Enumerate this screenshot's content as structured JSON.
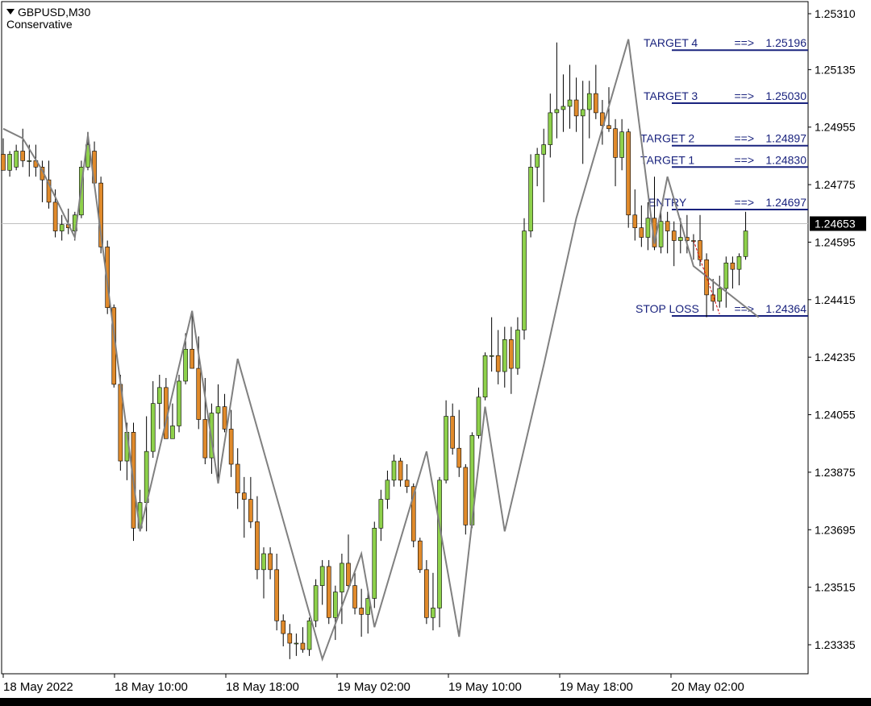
{
  "header": {
    "symbol": "GBPUSD,M30",
    "indicator": "Conservative"
  },
  "colors": {
    "bull": "#8ed14b",
    "bear": "#e08a2b",
    "wick": "#000000",
    "zigzag": "#808080",
    "level_line": "#1a237e",
    "level_text": "#1a237e",
    "current_price_bg": "#000000",
    "current_price_text": "#ffffff",
    "stop_path": "#cc0000"
  },
  "chart_data": {
    "type": "candlestick",
    "symbol": "GBPUSD",
    "timeframe": "M30",
    "y_axis": {
      "ylim": [
        1.2326,
        1.2536
      ],
      "ticks": [
        "1.25310",
        "1.25135",
        "1.24955",
        "1.24775",
        "1.24595",
        "1.24415",
        "1.24235",
        "1.24055",
        "1.23875",
        "1.23695",
        "1.23515",
        "1.23335"
      ]
    },
    "x_axis": {
      "ticks": [
        "18 May 2022",
        "18 May 10:00",
        "18 May 18:00",
        "19 May 02:00",
        "19 May 10:00",
        "19 May 18:00",
        "20 May 02:00"
      ]
    },
    "current_price": "1.24653",
    "levels": [
      {
        "label": "TARGET 4",
        "arrow": "==>",
        "value": "1.25196"
      },
      {
        "label": "TARGET 3",
        "arrow": "==>",
        "value": "1.25030"
      },
      {
        "label": "TARGET 2",
        "arrow": "==>",
        "value": "1.24897"
      },
      {
        "label": "TARGET 1",
        "arrow": "==>",
        "value": "1.24830"
      },
      {
        "label": "ENTRY",
        "arrow": "==>",
        "value": "1.24697"
      },
      {
        "label": "STOP LOSS",
        "arrow": "==>",
        "value": "1.24364"
      }
    ],
    "candles": [
      {
        "o": 1.2487,
        "h": 1.2492,
        "l": 1.2482,
        "c": 1.2482
      },
      {
        "o": 1.2482,
        "h": 1.2488,
        "l": 1.248,
        "c": 1.2487
      },
      {
        "o": 1.2483,
        "h": 1.249,
        "l": 1.2482,
        "c": 1.2488
      },
      {
        "o": 1.2488,
        "h": 1.2495,
        "l": 1.2483,
        "c": 1.2485
      },
      {
        "o": 1.2485,
        "h": 1.249,
        "l": 1.248,
        "c": 1.2485
      },
      {
        "o": 1.2485,
        "h": 1.249,
        "l": 1.248,
        "c": 1.2483
      },
      {
        "o": 1.2483,
        "h": 1.2485,
        "l": 1.2472,
        "c": 1.2479
      },
      {
        "o": 1.2479,
        "h": 1.2485,
        "l": 1.247,
        "c": 1.2472
      },
      {
        "o": 1.2472,
        "h": 1.2476,
        "l": 1.2461,
        "c": 1.2463
      },
      {
        "o": 1.2463,
        "h": 1.2468,
        "l": 1.246,
        "c": 1.2465
      },
      {
        "o": 1.2465,
        "h": 1.247,
        "l": 1.2462,
        "c": 1.2464
      },
      {
        "o": 1.2463,
        "h": 1.2469,
        "l": 1.246,
        "c": 1.2468
      },
      {
        "o": 1.2468,
        "h": 1.2485,
        "l": 1.2467,
        "c": 1.2483
      },
      {
        "o": 1.2483,
        "h": 1.2494,
        "l": 1.2482,
        "c": 1.249
      },
      {
        "o": 1.2488,
        "h": 1.2491,
        "l": 1.248,
        "c": 1.2478
      },
      {
        "o": 1.2478,
        "h": 1.248,
        "l": 1.2456,
        "c": 1.2458
      },
      {
        "o": 1.2458,
        "h": 1.246,
        "l": 1.2437,
        "c": 1.2439
      },
      {
        "o": 1.2439,
        "h": 1.244,
        "l": 1.2414,
        "c": 1.2415
      },
      {
        "o": 1.2415,
        "h": 1.2418,
        "l": 1.2388,
        "c": 1.2391
      },
      {
        "o": 1.2391,
        "h": 1.2403,
        "l": 1.2385,
        "c": 1.24
      },
      {
        "o": 1.24,
        "h": 1.2403,
        "l": 1.2366,
        "c": 1.237
      },
      {
        "o": 1.237,
        "h": 1.2382,
        "l": 1.2369,
        "c": 1.2378
      },
      {
        "o": 1.2378,
        "h": 1.2405,
        "l": 1.2369,
        "c": 1.2394
      },
      {
        "o": 1.2394,
        "h": 1.2416,
        "l": 1.2392,
        "c": 1.2409
      },
      {
        "o": 1.2409,
        "h": 1.2418,
        "l": 1.2401,
        "c": 1.2414
      },
      {
        "o": 1.2414,
        "h": 1.2417,
        "l": 1.2399,
        "c": 1.2398
      },
      {
        "o": 1.2398,
        "h": 1.2409,
        "l": 1.2398,
        "c": 1.2402
      },
      {
        "o": 1.2402,
        "h": 1.2418,
        "l": 1.24,
        "c": 1.2416
      },
      {
        "o": 1.2416,
        "h": 1.2431,
        "l": 1.2415,
        "c": 1.2426
      },
      {
        "o": 1.2426,
        "h": 1.2437,
        "l": 1.242,
        "c": 1.242
      },
      {
        "o": 1.242,
        "h": 1.243,
        "l": 1.2401,
        "c": 1.2404
      },
      {
        "o": 1.2404,
        "h": 1.2417,
        "l": 1.239,
        "c": 1.2392
      },
      {
        "o": 1.2392,
        "h": 1.2409,
        "l": 1.2387,
        "c": 1.2406
      },
      {
        "o": 1.2406,
        "h": 1.2415,
        "l": 1.2384,
        "c": 1.2408
      },
      {
        "o": 1.2408,
        "h": 1.2412,
        "l": 1.24,
        "c": 1.2401
      },
      {
        "o": 1.2401,
        "h": 1.2407,
        "l": 1.2386,
        "c": 1.239
      },
      {
        "o": 1.239,
        "h": 1.2395,
        "l": 1.2376,
        "c": 1.2381
      },
      {
        "o": 1.2381,
        "h": 1.2386,
        "l": 1.2367,
        "c": 1.2379
      },
      {
        "o": 1.2379,
        "h": 1.2386,
        "l": 1.237,
        "c": 1.2372
      },
      {
        "o": 1.2372,
        "h": 1.238,
        "l": 1.2354,
        "c": 1.2357
      },
      {
        "o": 1.2357,
        "h": 1.2364,
        "l": 1.2348,
        "c": 1.2362
      },
      {
        "o": 1.2362,
        "h": 1.2364,
        "l": 1.2354,
        "c": 1.2357
      },
      {
        "o": 1.2357,
        "h": 1.2362,
        "l": 1.2338,
        "c": 1.2341
      },
      {
        "o": 1.2341,
        "h": 1.2343,
        "l": 1.2333,
        "c": 1.2337
      },
      {
        "o": 1.2337,
        "h": 1.234,
        "l": 1.2329,
        "c": 1.2334
      },
      {
        "o": 1.2334,
        "h": 1.2337,
        "l": 1.233,
        "c": 1.2334
      },
      {
        "o": 1.2334,
        "h": 1.2339,
        "l": 1.2331,
        "c": 1.2332
      },
      {
        "o": 1.2332,
        "h": 1.2342,
        "l": 1.233,
        "c": 1.2341
      },
      {
        "o": 1.2341,
        "h": 1.2354,
        "l": 1.2339,
        "c": 1.2352
      },
      {
        "o": 1.2352,
        "h": 1.236,
        "l": 1.2346,
        "c": 1.2358
      },
      {
        "o": 1.2358,
        "h": 1.236,
        "l": 1.234,
        "c": 1.2342
      },
      {
        "o": 1.2342,
        "h": 1.2352,
        "l": 1.2335,
        "c": 1.235
      },
      {
        "o": 1.235,
        "h": 1.2362,
        "l": 1.234,
        "c": 1.2359
      },
      {
        "o": 1.2359,
        "h": 1.2368,
        "l": 1.2351,
        "c": 1.2352
      },
      {
        "o": 1.2352,
        "h": 1.2356,
        "l": 1.2343,
        "c": 1.2345
      },
      {
        "o": 1.2345,
        "h": 1.2351,
        "l": 1.2336,
        "c": 1.2343
      },
      {
        "o": 1.2343,
        "h": 1.235,
        "l": 1.2337,
        "c": 1.2348
      },
      {
        "o": 1.2348,
        "h": 1.2372,
        "l": 1.2345,
        "c": 1.237
      },
      {
        "o": 1.237,
        "h": 1.2382,
        "l": 1.2366,
        "c": 1.2379
      },
      {
        "o": 1.2379,
        "h": 1.2388,
        "l": 1.2376,
        "c": 1.2385
      },
      {
        "o": 1.2385,
        "h": 1.2393,
        "l": 1.2383,
        "c": 1.2391
      },
      {
        "o": 1.2391,
        "h": 1.2392,
        "l": 1.2383,
        "c": 1.2385
      },
      {
        "o": 1.2385,
        "h": 1.239,
        "l": 1.2381,
        "c": 1.2383
      },
      {
        "o": 1.2383,
        "h": 1.2384,
        "l": 1.2364,
        "c": 1.2366
      },
      {
        "o": 1.2366,
        "h": 1.2367,
        "l": 1.2356,
        "c": 1.2357
      },
      {
        "o": 1.2357,
        "h": 1.236,
        "l": 1.234,
        "c": 1.2342
      },
      {
        "o": 1.2342,
        "h": 1.2356,
        "l": 1.2338,
        "c": 1.2345
      },
      {
        "o": 1.2345,
        "h": 1.2386,
        "l": 1.2339,
        "c": 1.2385
      },
      {
        "o": 1.2385,
        "h": 1.241,
        "l": 1.2384,
        "c": 1.2405
      },
      {
        "o": 1.2405,
        "h": 1.2409,
        "l": 1.2393,
        "c": 1.2395
      },
      {
        "o": 1.2395,
        "h": 1.2407,
        "l": 1.2386,
        "c": 1.2389
      },
      {
        "o": 1.2389,
        "h": 1.239,
        "l": 1.2368,
        "c": 1.2371
      },
      {
        "o": 1.2371,
        "h": 1.24,
        "l": 1.237,
        "c": 1.2399
      },
      {
        "o": 1.2399,
        "h": 1.2414,
        "l": 1.2398,
        "c": 1.2411
      },
      {
        "o": 1.2411,
        "h": 1.2425,
        "l": 1.241,
        "c": 1.2424
      },
      {
        "o": 1.2424,
        "h": 1.2436,
        "l": 1.2419,
        "c": 1.2424
      },
      {
        "o": 1.2424,
        "h": 1.2432,
        "l": 1.2415,
        "c": 1.2419
      },
      {
        "o": 1.2419,
        "h": 1.2433,
        "l": 1.2414,
        "c": 1.2429
      },
      {
        "o": 1.2429,
        "h": 1.2433,
        "l": 1.2412,
        "c": 1.242
      },
      {
        "o": 1.242,
        "h": 1.2436,
        "l": 1.2418,
        "c": 1.2432
      },
      {
        "o": 1.2432,
        "h": 1.2467,
        "l": 1.2429,
        "c": 1.2463
      },
      {
        "o": 1.2463,
        "h": 1.2487,
        "l": 1.2461,
        "c": 1.2483
      },
      {
        "o": 1.2483,
        "h": 1.2489,
        "l": 1.2477,
        "c": 1.2487
      },
      {
        "o": 1.2487,
        "h": 1.2495,
        "l": 1.2472,
        "c": 1.249
      },
      {
        "o": 1.249,
        "h": 1.2506,
        "l": 1.2486,
        "c": 1.25
      },
      {
        "o": 1.25,
        "h": 1.2522,
        "l": 1.2492,
        "c": 1.2501
      },
      {
        "o": 1.2501,
        "h": 1.2512,
        "l": 1.2494,
        "c": 1.2502
      },
      {
        "o": 1.2502,
        "h": 1.2515,
        "l": 1.2495,
        "c": 1.2504
      },
      {
        "o": 1.2504,
        "h": 1.2511,
        "l": 1.2494,
        "c": 1.2499
      },
      {
        "o": 1.2499,
        "h": 1.251,
        "l": 1.2484,
        "c": 1.2501
      },
      {
        "o": 1.2501,
        "h": 1.251,
        "l": 1.2492,
        "c": 1.2506
      },
      {
        "o": 1.2506,
        "h": 1.2515,
        "l": 1.2498,
        "c": 1.25
      },
      {
        "o": 1.25,
        "h": 1.2504,
        "l": 1.249,
        "c": 1.2496
      },
      {
        "o": 1.2496,
        "h": 1.2508,
        "l": 1.2494,
        "c": 1.2495
      },
      {
        "o": 1.2495,
        "h": 1.2498,
        "l": 1.2477,
        "c": 1.2486
      },
      {
        "o": 1.2486,
        "h": 1.2498,
        "l": 1.2482,
        "c": 1.2494
      },
      {
        "o": 1.2494,
        "h": 1.2495,
        "l": 1.2464,
        "c": 1.2468
      },
      {
        "o": 1.2468,
        "h": 1.2476,
        "l": 1.246,
        "c": 1.2464
      },
      {
        "o": 1.2464,
        "h": 1.2471,
        "l": 1.2458,
        "c": 1.2461
      },
      {
        "o": 1.2461,
        "h": 1.2472,
        "l": 1.2457,
        "c": 1.2467
      },
      {
        "o": 1.2467,
        "h": 1.248,
        "l": 1.2457,
        "c": 1.2458
      },
      {
        "o": 1.2458,
        "h": 1.247,
        "l": 1.2456,
        "c": 1.2466
      },
      {
        "o": 1.2466,
        "h": 1.2469,
        "l": 1.2456,
        "c": 1.2463
      },
      {
        "o": 1.2463,
        "h": 1.2466,
        "l": 1.2452,
        "c": 1.246
      },
      {
        "o": 1.246,
        "h": 1.2467,
        "l": 1.2456,
        "c": 1.2461
      },
      {
        "o": 1.2461,
        "h": 1.2468,
        "l": 1.2456,
        "c": 1.246
      },
      {
        "o": 1.246,
        "h": 1.2462,
        "l": 1.2454,
        "c": 1.246
      },
      {
        "o": 1.246,
        "h": 1.2468,
        "l": 1.2452,
        "c": 1.2454
      },
      {
        "o": 1.2454,
        "h": 1.2456,
        "l": 1.2436,
        "c": 1.2443
      },
      {
        "o": 1.2443,
        "h": 1.2448,
        "l": 1.2438,
        "c": 1.2441
      },
      {
        "o": 1.2441,
        "h": 1.2449,
        "l": 1.2439,
        "c": 1.2445
      },
      {
        "o": 1.2445,
        "h": 1.2455,
        "l": 1.2439,
        "c": 1.2453
      },
      {
        "o": 1.2453,
        "h": 1.2455,
        "l": 1.2445,
        "c": 1.2451
      },
      {
        "o": 1.2451,
        "h": 1.2456,
        "l": 1.2446,
        "c": 1.2455
      },
      {
        "o": 1.2455,
        "h": 1.2469,
        "l": 1.2454,
        "c": 1.2463
      }
    ],
    "zigzag": [
      {
        "i": 0,
        "p": 1.2495
      },
      {
        "i": 3,
        "p": 1.2492
      },
      {
        "i": 6,
        "p": 1.2482
      },
      {
        "i": 11,
        "p": 1.2461
      },
      {
        "i": 13,
        "p": 1.2493
      },
      {
        "i": 21,
        "p": 1.2369
      },
      {
        "i": 29,
        "p": 1.2438
      },
      {
        "i": 33,
        "p": 1.2384
      },
      {
        "i": 36,
        "p": 1.2423
      },
      {
        "i": 49,
        "p": 1.2329
      },
      {
        "i": 55,
        "p": 1.2362
      },
      {
        "i": 57,
        "p": 1.2339
      },
      {
        "i": 65,
        "p": 1.2394
      },
      {
        "i": 70,
        "p": 1.2336
      },
      {
        "i": 74,
        "p": 1.2408
      },
      {
        "i": 77,
        "p": 1.2369
      },
      {
        "i": 83,
        "p": 1.2421
      },
      {
        "i": 88,
        "p": 1.2467
      },
      {
        "i": 96,
        "p": 1.2523
      },
      {
        "i": 100,
        "p": 1.2459
      },
      {
        "i": 102,
        "p": 1.248
      },
      {
        "i": 106,
        "p": 1.2452
      },
      {
        "i": 116,
        "p": 1.2436
      }
    ],
    "stop_path": [
      {
        "i": 106,
        "p": 1.246
      },
      {
        "i": 110,
        "p": 1.2437
      }
    ]
  }
}
